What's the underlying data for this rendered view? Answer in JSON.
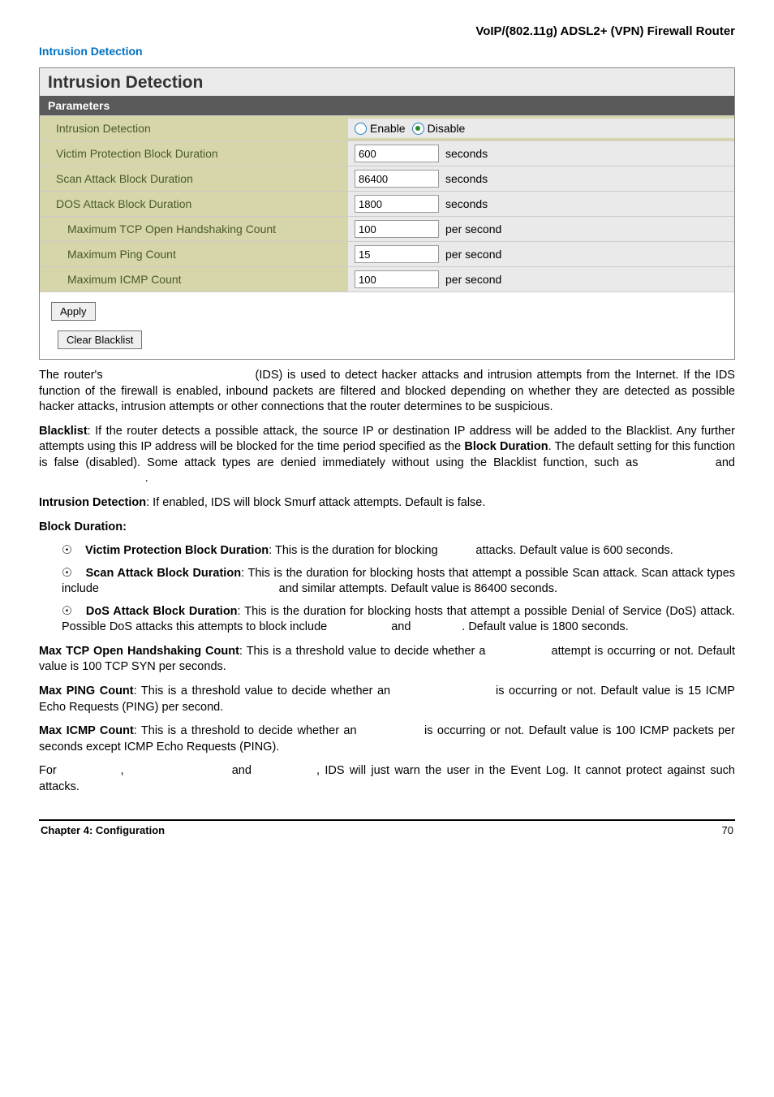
{
  "header": {
    "title": "VoIP/(802.11g) ADSL2+ (VPN) Firewall Router"
  },
  "section_heading": "Intrusion Detection",
  "panel": {
    "title": "Intrusion Detection",
    "subtitle": "Parameters",
    "rows": {
      "intrusion_detection": {
        "label": "Intrusion Detection",
        "enable": "Enable",
        "disable": "Disable"
      },
      "victim": {
        "label": "Victim Protection Block Duration",
        "value": "600",
        "unit": "seconds"
      },
      "scan": {
        "label": "Scan Attack Block Duration",
        "value": "86400",
        "unit": "seconds"
      },
      "dos": {
        "label": "DOS Attack Block Duration",
        "value": "1800",
        "unit": "seconds"
      },
      "tcp": {
        "label": "Maximum TCP Open Handshaking Count",
        "value": "100",
        "unit": "per second"
      },
      "ping": {
        "label": "Maximum Ping Count",
        "value": "15",
        "unit": "per second"
      },
      "icmp": {
        "label": "Maximum ICMP Count",
        "value": "100",
        "unit": "per second"
      }
    },
    "apply": "Apply",
    "clear": "Clear Blacklist"
  },
  "text": {
    "p1a": "The router's ",
    "p1b": " (IDS) is used to detect hacker attacks and intrusion attempts from the Internet. If the IDS function of the firewall is enabled, inbound packets are filtered and blocked depending on whether they are detected as possible hacker attacks, intrusion attempts or other connections that the router determines to be suspicious.",
    "p2_b1": "Blacklist",
    "p2a": ": If the router detects a possible attack, the source IP or destination IP address will be added to the Blacklist. Any further attempts using this IP address will be blocked for the time period specified as the ",
    "p2_b2": "Block Duration",
    "p2b": ". The default setting for this function is false (disabled). Some attack types are denied immediately without using the Blacklist function, such as ",
    "p2c": " and ",
    "p2d": ".",
    "p3_b": "Intrusion Detection",
    "p3": ": If enabled, IDS will block Smurf attack attempts. Default is false.",
    "p4": "Block Duration:",
    "bullet1_b": "Victim Protection Block Duration",
    "bullet1": ": This is the duration for blocking ",
    "bullet1_end": " attacks. Default value is 600 seconds.",
    "bullet2_b": "Scan Attack Block Duration",
    "bullet2a": ": This is the duration for blocking hosts that attempt a possible Scan attack. Scan attack types include ",
    "bullet2b": " and similar attempts. Default value is 86400 seconds.",
    "bullet3_b": "DoS Attack Block Duration",
    "bullet3a": ": This is the duration for blocking hosts that attempt a possible Denial of Service (DoS) attack. Possible DoS attacks this attempts to block include ",
    "bullet3b": " and ",
    "bullet3c": ". Default value is 1800 seconds.",
    "p5_b": "Max TCP Open Handshaking Count",
    "p5a": ": This is a threshold value to decide whether a ",
    "p5b": " attempt is occurring or not. Default value is 100 TCP SYN per seconds.",
    "p6_b": "Max PING Count",
    "p6a": ": This is a threshold value to decide whether an ",
    "p6b": " is occurring or not. Default value is 15 ICMP Echo Requests (PING) per second.",
    "p7_b": "Max ICMP Count",
    "p7a": ": This is a threshold to decide whether an ",
    "p7b": " is occurring or not. Default value is 100 ICMP packets per seconds except ICMP Echo Requests (PING).",
    "p8a": "For ",
    "p8b": ", ",
    "p8c": " and ",
    "p8d": ", IDS will just warn the user in the Event Log. It cannot protect against such attacks."
  },
  "footer": {
    "left": "Chapter 4: Configuration",
    "right": "70"
  }
}
